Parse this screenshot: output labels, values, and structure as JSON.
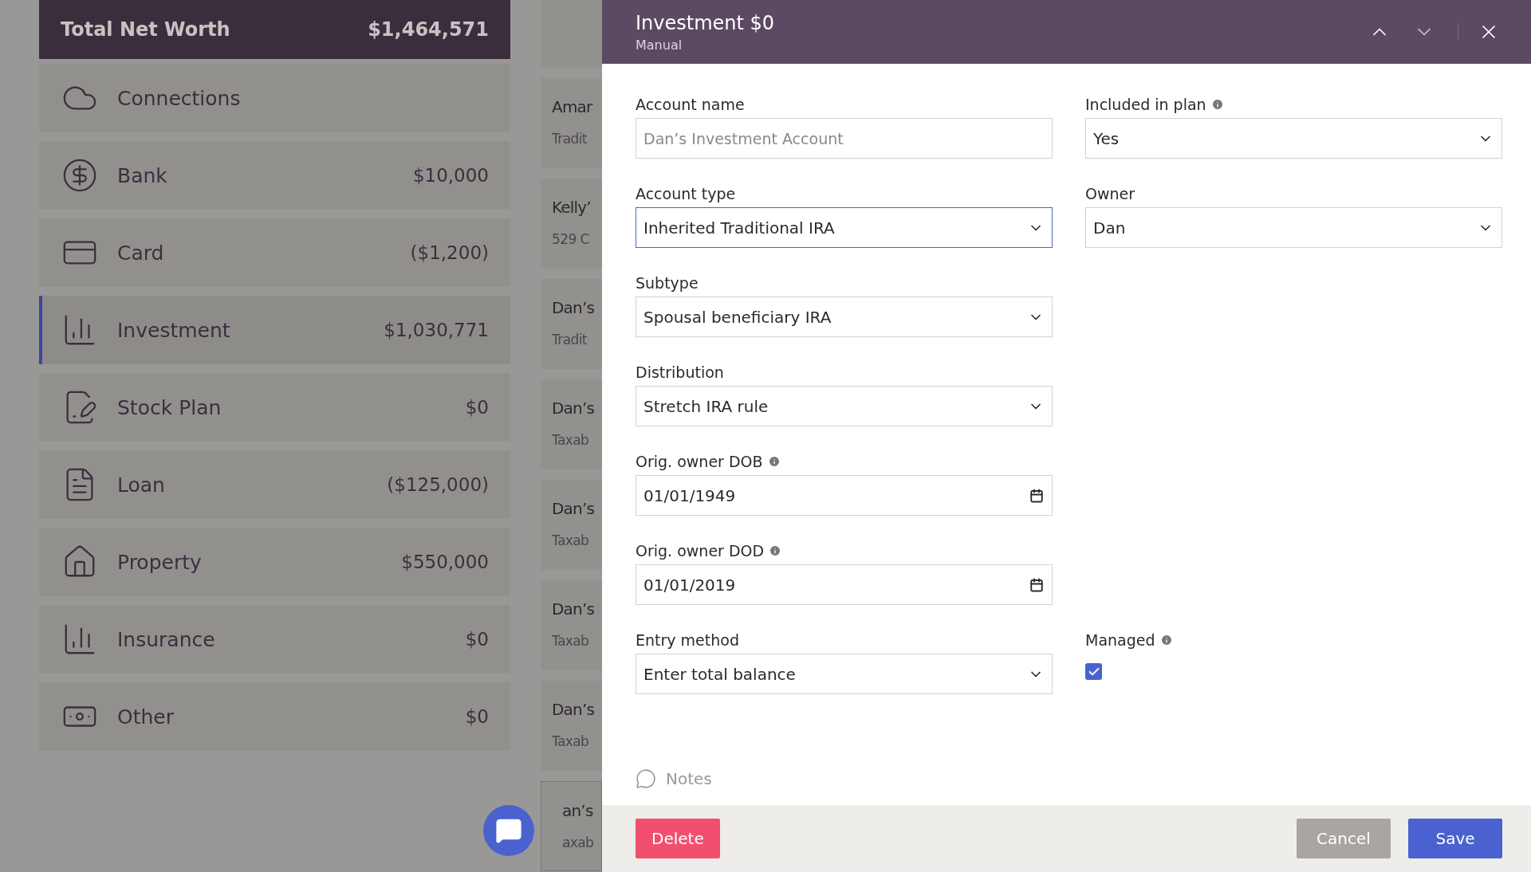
{
  "net_worth": {
    "label": "Total Net Worth",
    "value": "$1,464,571"
  },
  "categories": [
    {
      "label": "Connections",
      "selected": false
    },
    {
      "label": "Bank",
      "value": "$10,000",
      "selected": false
    },
    {
      "label": "Card",
      "value": "($1,200)",
      "selected": false
    },
    {
      "label": "Investment",
      "value": "$1,030,771",
      "selected": true
    },
    {
      "label": "Stock Plan",
      "value": "$0",
      "selected": false
    },
    {
      "label": "Loan",
      "value": "($125,000)",
      "selected": false
    },
    {
      "label": "Property",
      "value": "$550,000",
      "selected": false
    },
    {
      "label": "Insurance",
      "value": "$0",
      "selected": false
    },
    {
      "label": "Other",
      "value": "$0",
      "selected": false
    }
  ],
  "accounts": [
    {
      "name": "Amar",
      "type": "Tradit"
    },
    {
      "name": "Kelly’",
      "type": "529 C"
    },
    {
      "name": "Dan’s",
      "type": "Tradit"
    },
    {
      "name": "Dan’s",
      "type": "Taxab"
    },
    {
      "name": "Dan’s",
      "type": "Taxab"
    },
    {
      "name": "Dan’s",
      "type": "Taxab"
    },
    {
      "name": "Dan’s",
      "type": "Taxab"
    },
    {
      "name": "an’s",
      "type": "axab"
    }
  ],
  "panel": {
    "title": "Investment $0",
    "subtitle": "Manual",
    "rows": [
      {
        "fields": [
          {
            "kind": "text",
            "label": "Account name",
            "placeholder": "Dan’s Investment Account",
            "info": false
          },
          {
            "kind": "select",
            "label": "Included in plan",
            "value": "Yes",
            "info": true,
            "focused": false
          }
        ]
      },
      {
        "fields": [
          {
            "kind": "select",
            "label": "Account type",
            "value": "Inherited Traditional IRA",
            "info": false,
            "focused": true
          },
          {
            "kind": "select",
            "label": "Owner",
            "value": "Dan",
            "info": false,
            "focused": false
          }
        ]
      },
      {
        "fields": [
          {
            "kind": "select",
            "label": "Subtype",
            "value": "Spousal beneficiary IRA",
            "info": false,
            "focused": false
          }
        ]
      },
      {
        "fields": [
          {
            "kind": "select",
            "label": "Distribution",
            "value": "Stretch IRA rule",
            "info": false,
            "focused": false
          }
        ]
      },
      {
        "fields": [
          {
            "kind": "date",
            "label": "Orig. owner DOB",
            "value": "01/01/1949",
            "info": true
          }
        ]
      },
      {
        "fields": [
          {
            "kind": "date",
            "label": "Orig. owner DOD",
            "value": "01/01/2019",
            "info": true
          }
        ]
      },
      {
        "fields": [
          {
            "kind": "select",
            "label": "Entry method",
            "value": "Enter total balance",
            "info": false,
            "focused": false
          },
          {
            "kind": "checkbox",
            "label": "Managed",
            "info": true,
            "checked": true
          }
        ]
      }
    ],
    "notes": "Notes",
    "buttons": {
      "delete": "Delete",
      "cancel": "Cancel",
      "save": "Save"
    }
  }
}
